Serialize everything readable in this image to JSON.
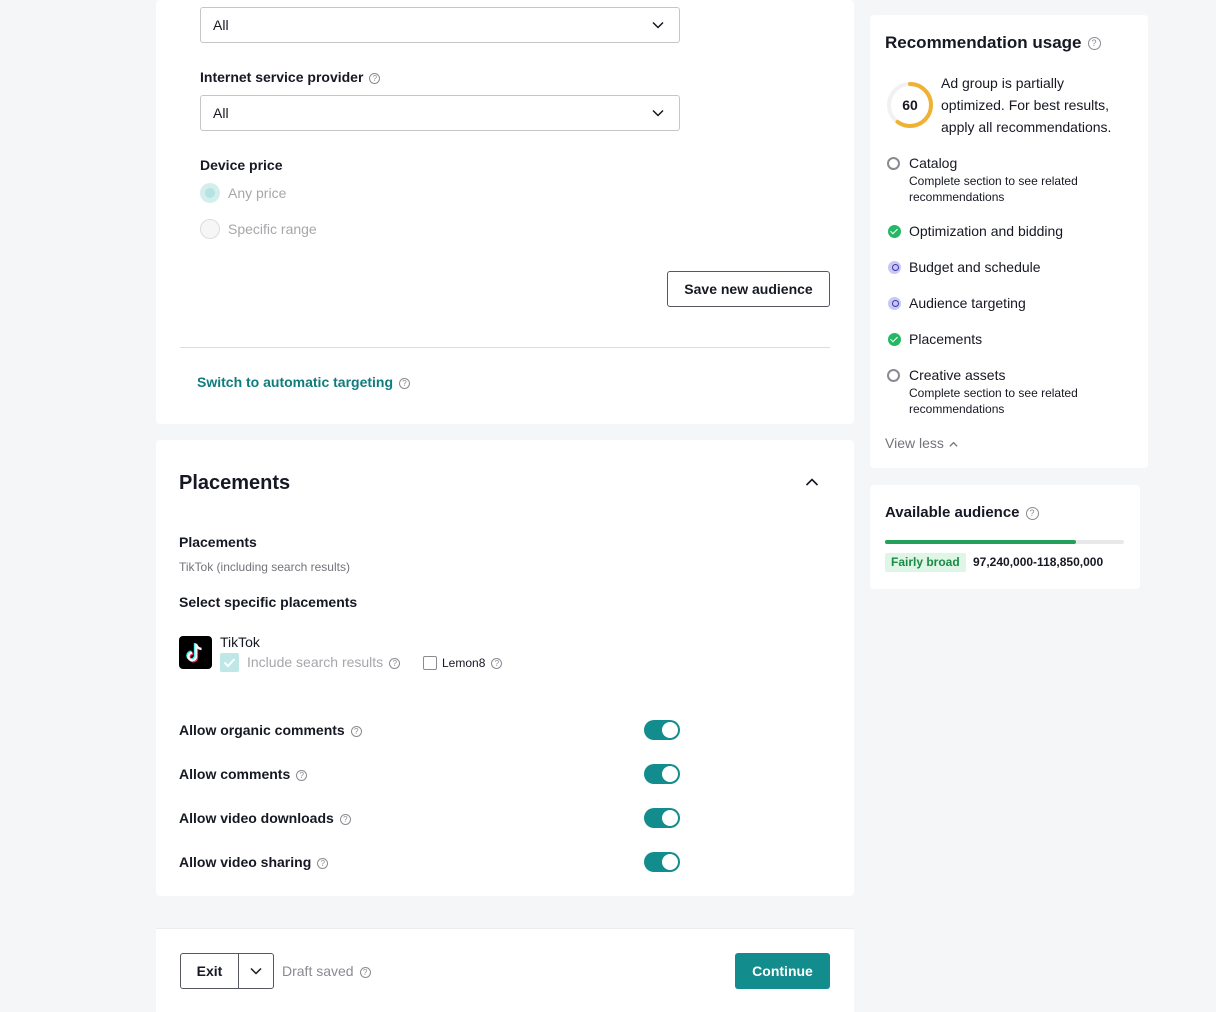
{
  "targeting": {
    "top_select_value": "All",
    "isp_label": "Internet service provider",
    "isp_value": "All",
    "device_price_label": "Device price",
    "device_price_options": [
      "Any price",
      "Specific range"
    ],
    "save_audience_label": "Save new audience",
    "switch_auto_label": "Switch to automatic targeting"
  },
  "placements": {
    "section_title": "Placements",
    "placements_label": "Placements",
    "placements_desc": "TikTok (including search results)",
    "select_specific_label": "Select specific placements",
    "tiktok_label": "TikTok",
    "include_search_label": "Include search results",
    "lemon8_label": "Lemon8",
    "toggles": [
      {
        "label": "Allow organic comments",
        "on": true
      },
      {
        "label": "Allow comments",
        "on": true
      },
      {
        "label": "Allow video downloads",
        "on": true
      },
      {
        "label": "Allow video sharing",
        "on": true
      }
    ]
  },
  "footer": {
    "exit_label": "Exit",
    "draft_saved": "Draft saved",
    "continue_label": "Continue"
  },
  "recommendation": {
    "title": "Recommendation usage",
    "score": "60",
    "score_fraction": 0.6,
    "summary": "Ad group is partially optimized. For best results, apply all recommendations.",
    "items": [
      {
        "title": "Catalog",
        "status": "incomplete",
        "subtitle": "Complete section to see related recommendations"
      },
      {
        "title": "Optimization and bidding",
        "status": "done",
        "subtitle": ""
      },
      {
        "title": "Budget and schedule",
        "status": "tip",
        "subtitle": ""
      },
      {
        "title": "Audience targeting",
        "status": "tip",
        "subtitle": ""
      },
      {
        "title": "Placements",
        "status": "done",
        "subtitle": ""
      },
      {
        "title": "Creative assets",
        "status": "incomplete",
        "subtitle": "Complete section to see related recommendations"
      }
    ],
    "view_less": "View less"
  },
  "audience": {
    "title": "Available audience",
    "level": "Fairly broad",
    "range": "97,240,000-118,850,000",
    "meter_fraction": 0.8
  },
  "colors": {
    "accent": "#128c8c",
    "link": "#0f7d7d",
    "success": "#25b864",
    "score_ring": "#f0b232",
    "badge_bg": "#dff5e6",
    "badge_text": "#1a8a46"
  }
}
